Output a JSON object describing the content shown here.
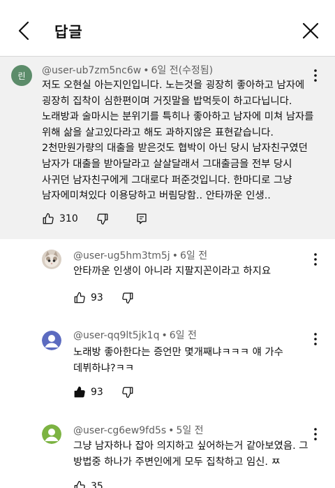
{
  "header": {
    "title": "답글"
  },
  "top_comment": {
    "avatar_text": "린",
    "user": "@user-ub7zm5nc6w",
    "time": "6일 전(수정됨)",
    "text": "저도 오현실 아는지인입니다. 노는것을 굉장히 좋아하고 남자에 굉장히 집착이 심한편이며 거짓말을 밥먹듯이 하고다닙니다. 노래방과 술마시는 분위기를 특히나 좋아하고 남자에 미쳐 남자를 위해 삶을 살고있다라고 해도 과하지않은 표현같습니다. 2천만원가량의 대출을 받은것도 협박이 아닌 당시 남자친구였던 남자가 대출을 받아달라고 살살달래서 그대출금을 전부 당시 사귀던 남자친구에게 그대로다 퍼준것입니다. 한마디로 그냥 남자에미쳐있다 이용당하고 버림당함.. 안타까운 인생..",
    "likes": "310"
  },
  "replies": [
    {
      "user": "@user-ug5hm3tm5j",
      "time": "6일 전",
      "text": "안타까운 인생이 아니라 지팔지꼰이라고 하지요",
      "likes": "93",
      "avatar": "cat-photo",
      "liked": false
    },
    {
      "user": "@user-qq9lt5jk1q",
      "time": "6일 전",
      "text": "노래방 좋아한다는 증언만 몇개째냐ㅋㅋㅋ 얘 가수 데뷔하냐?ㅋㅋ",
      "likes": "93",
      "avatar": "default-person",
      "avatar_color": "#5c6bc0",
      "liked": true
    },
    {
      "user": "@user-cg6ew9fd5s",
      "time": "5일 전",
      "text": "그냥 남자하나 잡아 의지하고 싶어하는거 같아보였음. 그 방법중 하나가 주변인에게 모두 집착하고 임신. ㅉ",
      "likes": "35",
      "avatar": "default-person",
      "avatar_color": "#7cb342",
      "liked": false
    }
  ],
  "colors": {
    "highlight_bg": "#f1f1f1",
    "meta_text": "#606060"
  }
}
